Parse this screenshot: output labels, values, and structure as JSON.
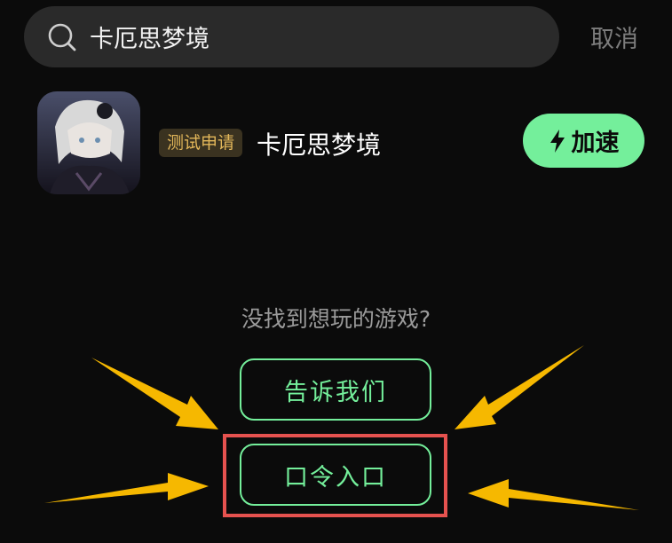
{
  "search": {
    "value": "卡厄思梦境",
    "cancel_label": "取消"
  },
  "result": {
    "badge": "测试申请",
    "game_name": "卡厄思梦境",
    "accelerate_label": "加速",
    "accelerate_icon": "bolt-icon"
  },
  "not_found": {
    "prompt": "没找到想玩的游戏?",
    "tell_us_label": "告诉我们",
    "passcode_label": "口令入口"
  },
  "colors": {
    "background": "#0b0b0b",
    "accent_green": "#74ef9b",
    "badge_text": "#e3b75a",
    "highlight_red": "#e6524f",
    "arrow_yellow": "#f6b800"
  }
}
